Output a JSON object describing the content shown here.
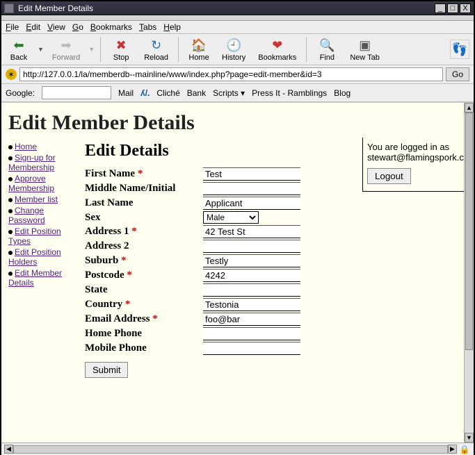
{
  "window": {
    "title": "Edit Member Details",
    "buttons": {
      "min": "_",
      "max": "□",
      "close": "X"
    }
  },
  "menubar": {
    "file": "File",
    "edit": "Edit",
    "view": "View",
    "go": "Go",
    "bookmarks": "Bookmarks",
    "tabs": "Tabs",
    "help": "Help"
  },
  "toolbar": {
    "back": "Back",
    "forward": "Forward",
    "stop": "Stop",
    "reload": "Reload",
    "home": "Home",
    "history": "History",
    "bookmarks": "Bookmarks",
    "find": "Find",
    "newtab": "New Tab"
  },
  "addressbar": {
    "url": "http://127.0.0.1/la/memberdb--mainline/www/index.php?page=edit-member&id=3",
    "go": "Go"
  },
  "bookmarkbar": {
    "google": "Google:",
    "mail": "Mail",
    "cliche": "Cliché",
    "bank": "Bank",
    "scripts": "Scripts ▾",
    "pressit": "Press It - Ramblings",
    "blog": "Blog"
  },
  "page": {
    "title": "Edit Member Details",
    "nav": [
      "Home",
      "Sign-up for Membership",
      "Approve Membership",
      "Member list",
      "Change Password",
      "Edit Position Types",
      "Edit Position Holders",
      "Edit Member Details"
    ],
    "form": {
      "heading": "Edit Details",
      "fields": {
        "first_name": {
          "label": "First Name",
          "required": true,
          "value": "Test"
        },
        "middle": {
          "label": "Middle Name/Initial",
          "required": false,
          "value": ""
        },
        "last_name": {
          "label": "Last Name",
          "required": false,
          "value": "Applicant"
        },
        "sex": {
          "label": "Sex",
          "required": false,
          "value": "Male"
        },
        "address1": {
          "label": "Address 1",
          "required": true,
          "value": "42 Test St"
        },
        "address2": {
          "label": "Address 2",
          "required": false,
          "value": ""
        },
        "suburb": {
          "label": "Suburb",
          "required": true,
          "value": "Testly"
        },
        "postcode": {
          "label": "Postcode",
          "required": true,
          "value": "4242"
        },
        "state": {
          "label": "State",
          "required": false,
          "value": ""
        },
        "country": {
          "label": "Country",
          "required": true,
          "value": "Testonia"
        },
        "email": {
          "label": "Email Address",
          "required": true,
          "value": "foo@bar"
        },
        "home_phone": {
          "label": "Home Phone",
          "required": false,
          "value": ""
        },
        "mobile_phone": {
          "label": "Mobile Phone",
          "required": false,
          "value": ""
        }
      },
      "submit": "Submit"
    },
    "login": {
      "line1": "You are logged in as",
      "user": "stewart@flamingspork.c",
      "logout": "Logout"
    }
  }
}
